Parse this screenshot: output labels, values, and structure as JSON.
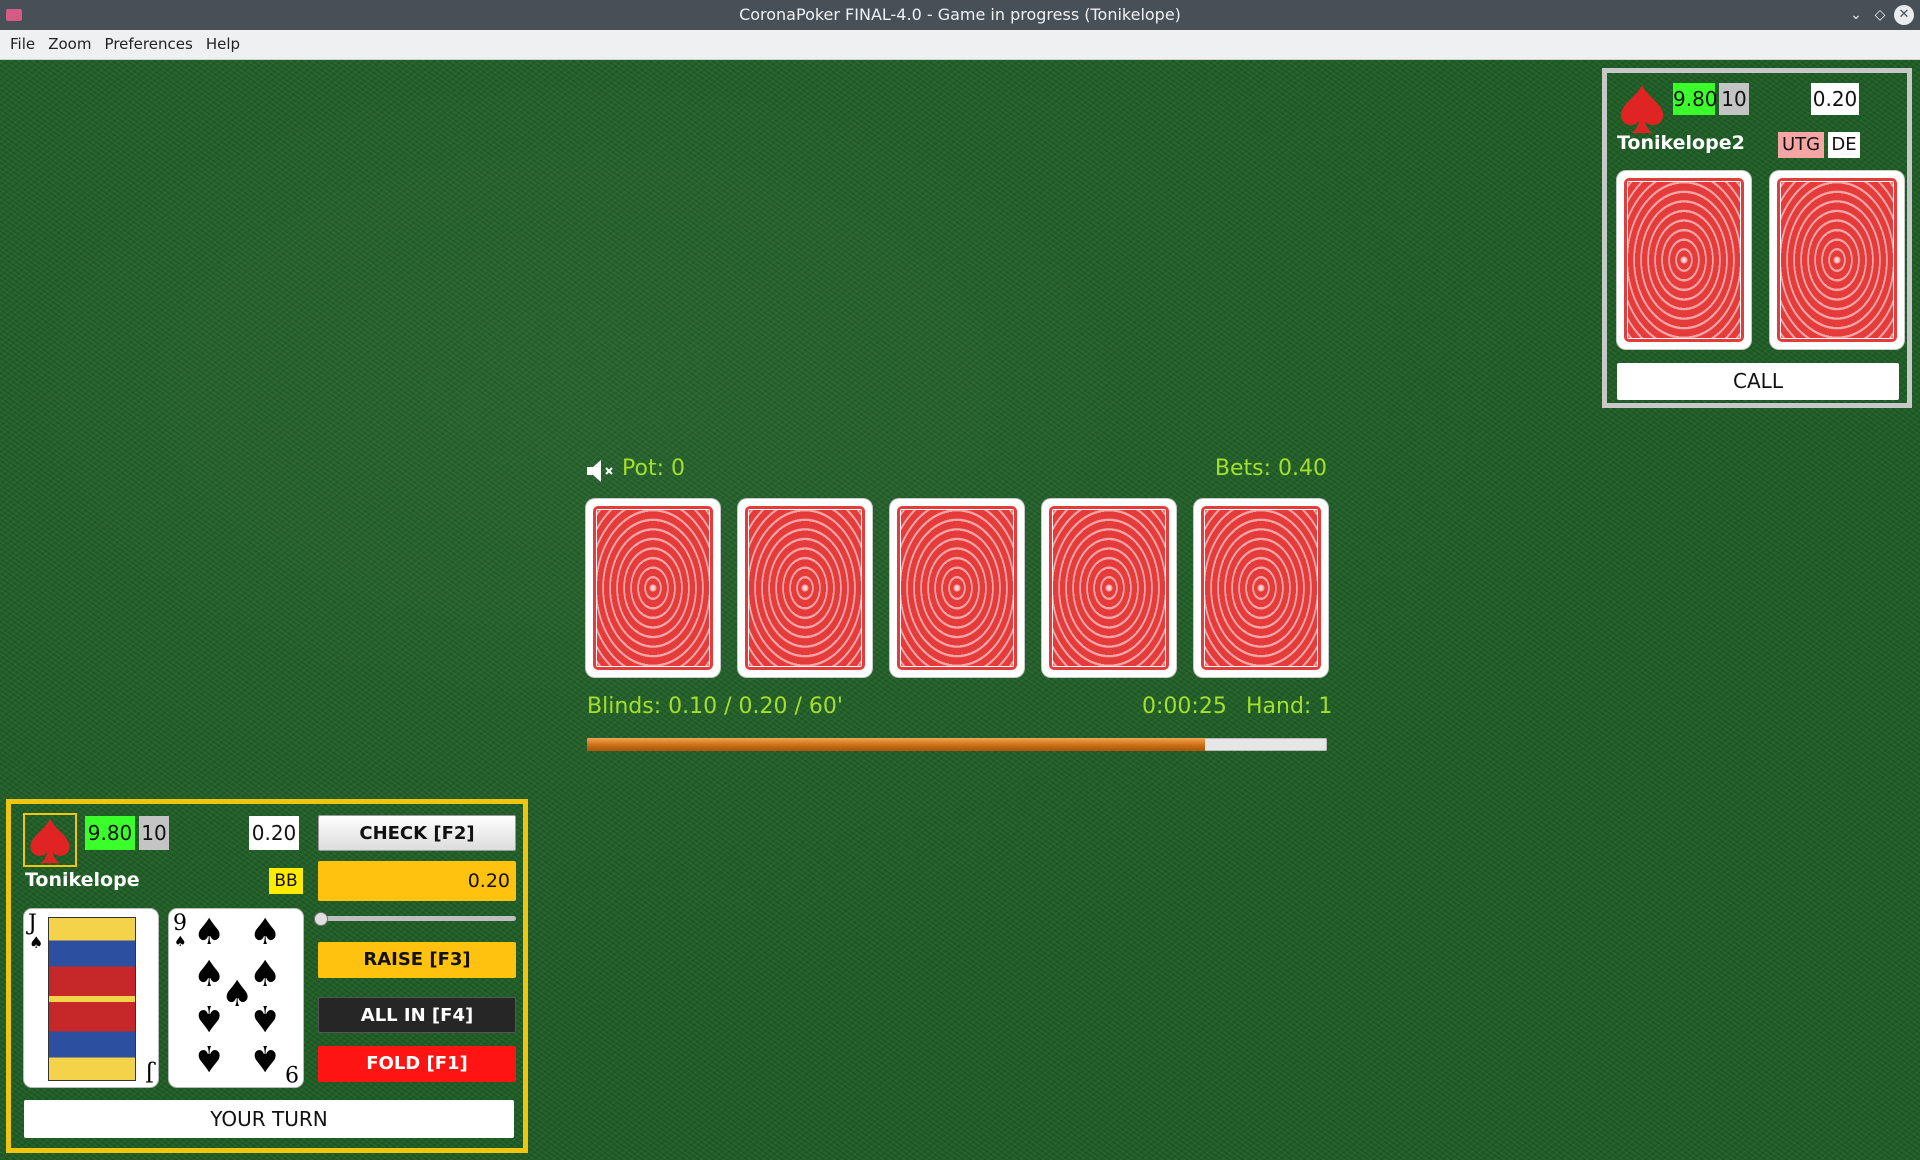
{
  "window": {
    "title": "CoronaPoker FINAL-4.0 - Game in progress (Tonikelope)"
  },
  "menu": [
    "File",
    "Zoom",
    "Preferences",
    "Help"
  ],
  "board": {
    "pot_label": "Pot: 0",
    "bets_label": "Bets: 0.40",
    "blinds_label": "Blinds: 0.10 / 0.20 / 60'",
    "timer": "0:00:25",
    "hand_label": "Hand: 1",
    "blind_timer_progress": 0.835,
    "community_cards": [
      "face-down",
      "face-down",
      "face-down",
      "face-down",
      "face-down"
    ]
  },
  "opponent": {
    "name": "Tonikelope2",
    "stack": "9.80",
    "rebuys": "10",
    "bet": "0.20",
    "position_badge": "UTG",
    "role_badge": "DE",
    "cards": [
      "face-down",
      "face-down"
    ],
    "action_label": "CALL"
  },
  "player": {
    "name": "Tonikelope",
    "stack": "9.80",
    "rebuys": "10",
    "bet": "0.20",
    "role_badge": "BB",
    "cards": [
      {
        "rank": "J",
        "suit": "spades"
      },
      {
        "rank": "9",
        "suit": "spades"
      }
    ],
    "status_label": "YOUR TURN"
  },
  "actions": {
    "check_label": "CHECK [F2]",
    "raise_amount": "0.20",
    "raise_slider_value": 0,
    "raise_label": "RAISE [F3]",
    "allin_label": "ALL IN [F4]",
    "fold_label": "FOLD [F1]"
  },
  "colors": {
    "felt": "#1f5e25",
    "lime_text": "#a3e02b",
    "player_highlight": "#f1c40f",
    "raise_yellow": "#ffc20e",
    "fold_red": "#ff1414",
    "stack_green": "#3aff2b",
    "card_back_red": "#e63b3b"
  },
  "icons": [
    "mute-speaker-icon",
    "spade-avatar-icon",
    "card-back-pattern"
  ]
}
